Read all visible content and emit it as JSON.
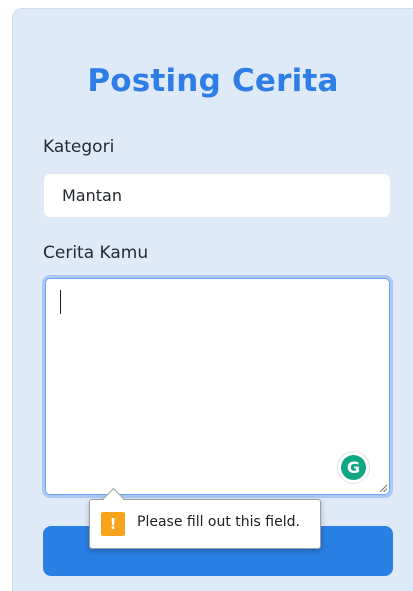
{
  "form": {
    "title": "Posting Cerita",
    "category_label": "Kategori",
    "category_value": "Mantan",
    "story_label": "Cerita Kamu",
    "story_value": "",
    "submit_label": ""
  },
  "validation": {
    "message": "Please fill out this field.",
    "icon_glyph": "!",
    "icon": "warning-icon"
  },
  "grammarly": {
    "glyph": "G",
    "icon": "grammarly-icon"
  },
  "colors": {
    "accent": "#2a7fe4",
    "title": "#2f7ee6",
    "card_background": "#dfeaf9",
    "focus_ring": "#a9c9f4",
    "warning": "#f7a21b",
    "grammarly": "#11a683"
  }
}
